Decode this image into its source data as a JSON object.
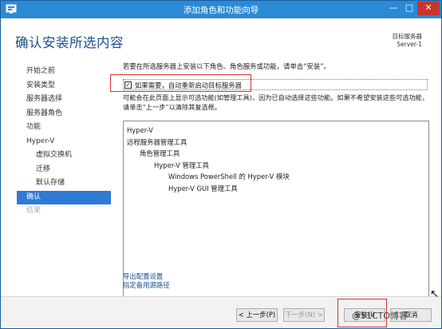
{
  "window": {
    "title": "添加角色和功能向导",
    "controls": {
      "minimize": "—",
      "maximize": "□",
      "close": "✕"
    }
  },
  "header": {
    "page_title": "确认安装所选内容",
    "destination_label": "目标服务器",
    "destination_server": "Server-1"
  },
  "nav": {
    "items": [
      {
        "label": "开始之前",
        "state": "normal",
        "sub": false
      },
      {
        "label": "安装类型",
        "state": "normal",
        "sub": false
      },
      {
        "label": "服务器选择",
        "state": "normal",
        "sub": false
      },
      {
        "label": "服务器角色",
        "state": "normal",
        "sub": false
      },
      {
        "label": "功能",
        "state": "normal",
        "sub": false
      },
      {
        "label": "Hyper-V",
        "state": "normal",
        "sub": false
      },
      {
        "label": "虚拟交换机",
        "state": "normal",
        "sub": true
      },
      {
        "label": "迁移",
        "state": "normal",
        "sub": true
      },
      {
        "label": "默认存储",
        "state": "normal",
        "sub": true
      },
      {
        "label": "确认",
        "state": "active",
        "sub": false
      },
      {
        "label": "结果",
        "state": "disabled",
        "sub": false
      }
    ]
  },
  "content": {
    "intro": "若要在所选服务器上安装以下角色、角色服务或功能，请单击“安装”。",
    "restart_checkbox": {
      "label": "如果需要，自动重新启动目标服务器",
      "checked": true,
      "mark": "✓"
    },
    "optional_note": "可能会在此页面上显示可选功能(如管理工具)，因为已自动选择这些功能。如果不希望安装这些可选功能，请单击“上一步”以清除其复选框。",
    "features": [
      {
        "label": "Hyper-V",
        "level": 0
      },
      {
        "label": "远程服务器管理工具",
        "level": 1
      },
      {
        "label": "角色管理工具",
        "level": 2
      },
      {
        "label": "Hyper-V 管理工具",
        "level": 3
      },
      {
        "label": "Windows PowerShell 的 Hyper-V 模块",
        "level": 4
      },
      {
        "label": "Hyper-V GUI 管理工具",
        "level": 4
      }
    ],
    "export_link": "导出配置设置",
    "source_link": "指定备用源路径"
  },
  "footer": {
    "prev_label": "< 上一步(P)",
    "next_label": "下一步(N) >",
    "install_label": "安装(I)",
    "cancel_label": "取消"
  },
  "watermark": "@51CTO博客",
  "colors": {
    "titlebar": "#2a8ad6",
    "accent": "#2e7bd5",
    "title_text": "#1b4f8c",
    "highlight": "#e03030"
  }
}
